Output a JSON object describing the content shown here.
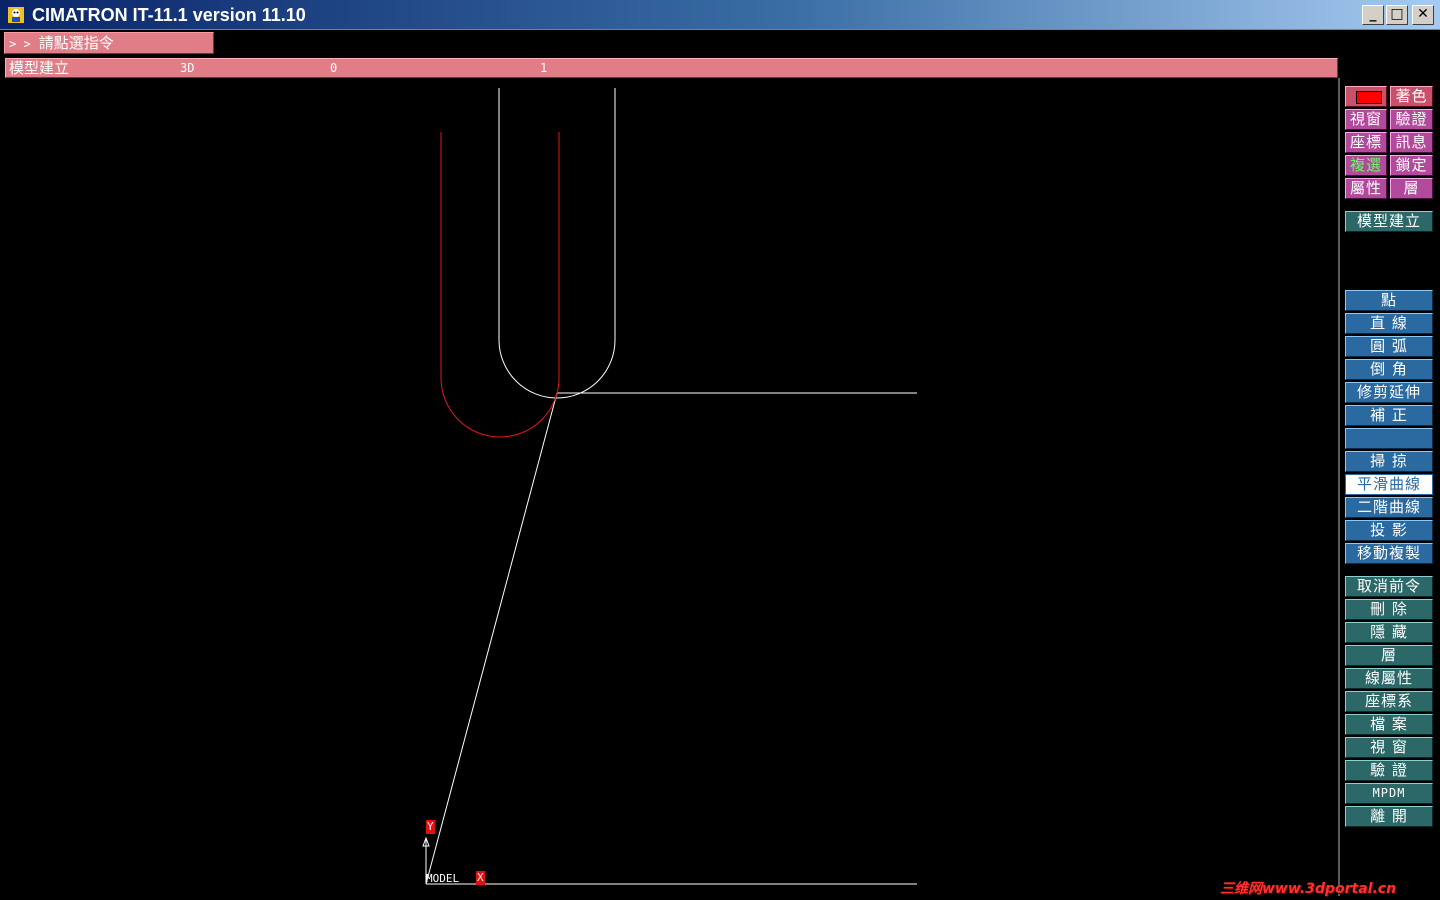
{
  "window": {
    "title": "CIMATRON IT-11.1 version 11.10",
    "minimize": "_",
    "maximize": "□",
    "close": "✕"
  },
  "prompt": {
    "arrows": "> >",
    "text": "請點選指令"
  },
  "status": {
    "mode": "模型建立",
    "dim": "3D",
    "field2": "0",
    "field3": "1"
  },
  "axes": {
    "y": "Y",
    "x": "X",
    "model": "MODEL"
  },
  "menu": {
    "row1_right": "著色",
    "row2_left": "視窗",
    "row2_right": "驗證",
    "row3_left": "座標",
    "row3_right": "訊息",
    "row4_left": "複選",
    "row4_right": "鎖定",
    "row5_left": "屬性",
    "row5_right": "層",
    "context": "模型建立",
    "geom": [
      "點",
      "直 線",
      "圓 弧",
      "倒 角",
      "修剪延伸",
      "補 正",
      "",
      "掃 掠",
      "平滑曲線",
      "二階曲線",
      "投 影",
      "移動複製"
    ],
    "general": [
      "取消前令",
      "刪 除",
      "隱 藏",
      "層",
      "線屬性",
      "座標系",
      "檔 案",
      "視 窗",
      "驗 證",
      "MPDM",
      "離 開"
    ]
  },
  "colors": {
    "curve_white": "#ffffff",
    "curve_red": "#e01818"
  },
  "watermark": "三维网www.3dportal.cn"
}
